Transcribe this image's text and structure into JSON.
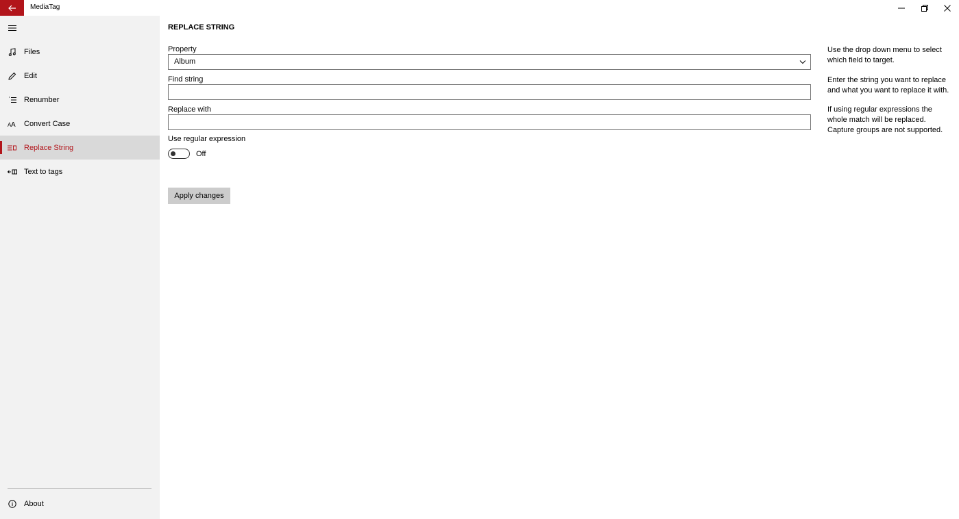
{
  "window": {
    "title": "MediaTag",
    "accent_color": "#b2151b",
    "controls": [
      "minimize-icon",
      "restore-icon",
      "close-icon"
    ]
  },
  "sidebar": {
    "items": [
      {
        "label": "Files",
        "icon": "music-note-icon"
      },
      {
        "label": "Edit",
        "icon": "pencil-icon"
      },
      {
        "label": "Renumber",
        "icon": "numbered-list-icon"
      },
      {
        "label": "Convert Case",
        "icon": "font-case-icon"
      },
      {
        "label": "Replace String",
        "icon": "replace-icon",
        "selected": true
      },
      {
        "label": "Text to tags",
        "icon": "text-to-tag-icon"
      }
    ],
    "footer": {
      "label": "About",
      "icon": "info-icon"
    }
  },
  "main": {
    "title": "REPLACE STRING",
    "property": {
      "label": "Property",
      "value": "Album"
    },
    "find": {
      "label": "Find string",
      "value": ""
    },
    "replace": {
      "label": "Replace with",
      "value": ""
    },
    "regex": {
      "label": "Use regular expression",
      "state_text": "Off",
      "on": false
    },
    "apply_label": "Apply changes"
  },
  "help": {
    "p1": [
      "Use the drop down menu to select",
      "which field to target."
    ],
    "p2": [
      "Enter the string you want to replace",
      "and what you want to replace it with."
    ],
    "p3": [
      "If using regular expressions the",
      "whole match will be replaced.",
      "Capture groups are not supported."
    ]
  }
}
